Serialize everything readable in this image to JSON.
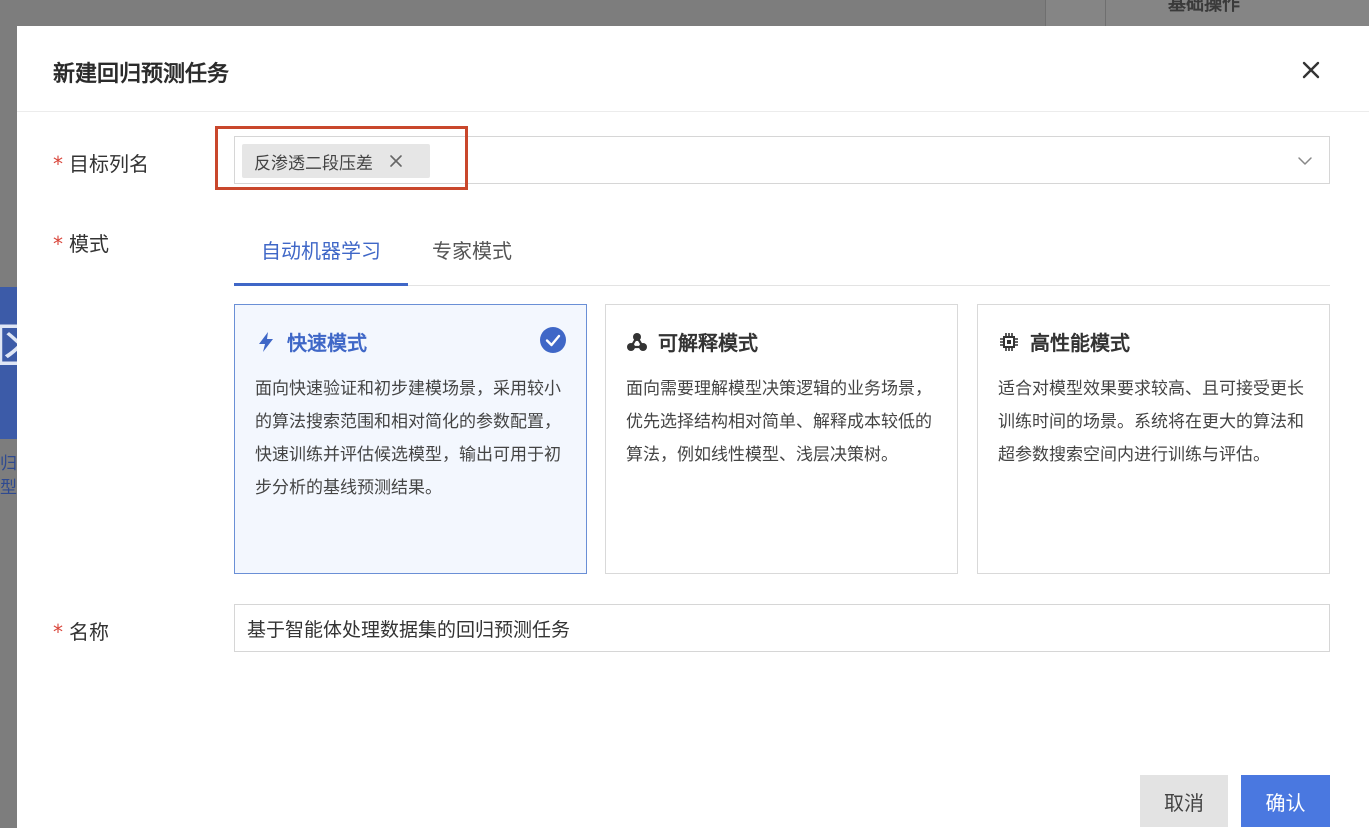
{
  "background": {
    "right_text": "基础操作",
    "left_glyph": "区",
    "left_text_1": "归预",
    "left_text_2": "型预"
  },
  "dialog": {
    "title": "新建回归预测任务",
    "close_icon": "close-icon"
  },
  "form": {
    "required_mark": "*",
    "target_column": {
      "label": "目标列名",
      "selected_tags": [
        "反渗透二段压差"
      ],
      "arrow_icon": "chevron-down-icon"
    },
    "mode": {
      "label": "模式",
      "tabs": [
        {
          "label": "自动机器学习",
          "active": true
        },
        {
          "label": "专家模式",
          "active": false
        }
      ],
      "cards": [
        {
          "icon": "lightning-icon",
          "title": "快速模式",
          "description": "面向快速验证和初步建模场景，采用较小的算法搜索范围和相对简化的参数配置，快速训练并评估候选模型，输出可用于初步分析的基线预测结果。",
          "selected": true
        },
        {
          "icon": "network-nodes-icon",
          "title": "可解释模式",
          "description": "面向需要理解模型决策逻辑的业务场景，优先选择结构相对简单、解释成本较低的算法，例如线性模型、浅层决策树。",
          "selected": false
        },
        {
          "icon": "chip-icon",
          "title": "高性能模式",
          "description": "适合对模型效果要求较高、且可接受更长训练时间的场景。系统将在更大的算法和超参数搜索空间内进行训练与评估。",
          "selected": false
        }
      ]
    },
    "name": {
      "label": "名称",
      "value": "基于智能体处理数据集的回归预测任务"
    }
  },
  "footer": {
    "cancel_label": "取消",
    "confirm_label": "确认"
  },
  "colors": {
    "accent": "#3f67c7",
    "primary_button": "#4a78e0",
    "required": "#d9453a",
    "highlight_box": "#c9472c"
  }
}
